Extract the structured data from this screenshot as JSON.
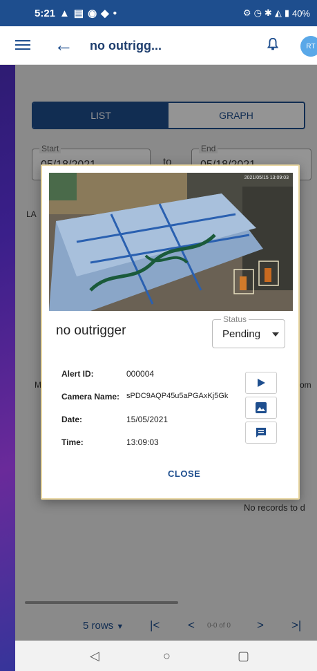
{
  "statusbar": {
    "time": "5:21",
    "battery": "40%"
  },
  "appbar": {
    "title": "no outrigg...",
    "avatar_initials": "RT"
  },
  "view_toggle": {
    "list_label": "LIST",
    "graph_label": "GRAPH",
    "active": "LIST"
  },
  "date_range": {
    "start_label": "Start",
    "start_value": "05/18/2021",
    "separator": "to",
    "end_label": "End",
    "end_value": "05/18/2021"
  },
  "background": {
    "side_text_la": "LA",
    "side_text_m": "M",
    "side_text_om": "om",
    "no_records": "No records to d"
  },
  "pagination": {
    "rows_label": "5 rows",
    "range_text": "0-0 of 0"
  },
  "modal": {
    "photo_timestamp": "2021/05/15 13:09:03",
    "alert_title": "no outrigger",
    "status": {
      "label": "Status",
      "value": "Pending"
    },
    "fields": [
      {
        "key": "Alert ID:",
        "value": "000004"
      },
      {
        "key": "Camera Name:",
        "value": "sPDC9AQP45u5aPGAxKj5Gk"
      },
      {
        "key": "Date:",
        "value": "15/05/2021"
      },
      {
        "key": "Time:",
        "value": "13:09:03"
      }
    ],
    "close_label": "CLOSE",
    "actions": [
      "play-icon",
      "image-icon",
      "comment-icon"
    ]
  },
  "colors": {
    "primary": "#1e4e8e",
    "modal_border": "#e8d6a0"
  }
}
